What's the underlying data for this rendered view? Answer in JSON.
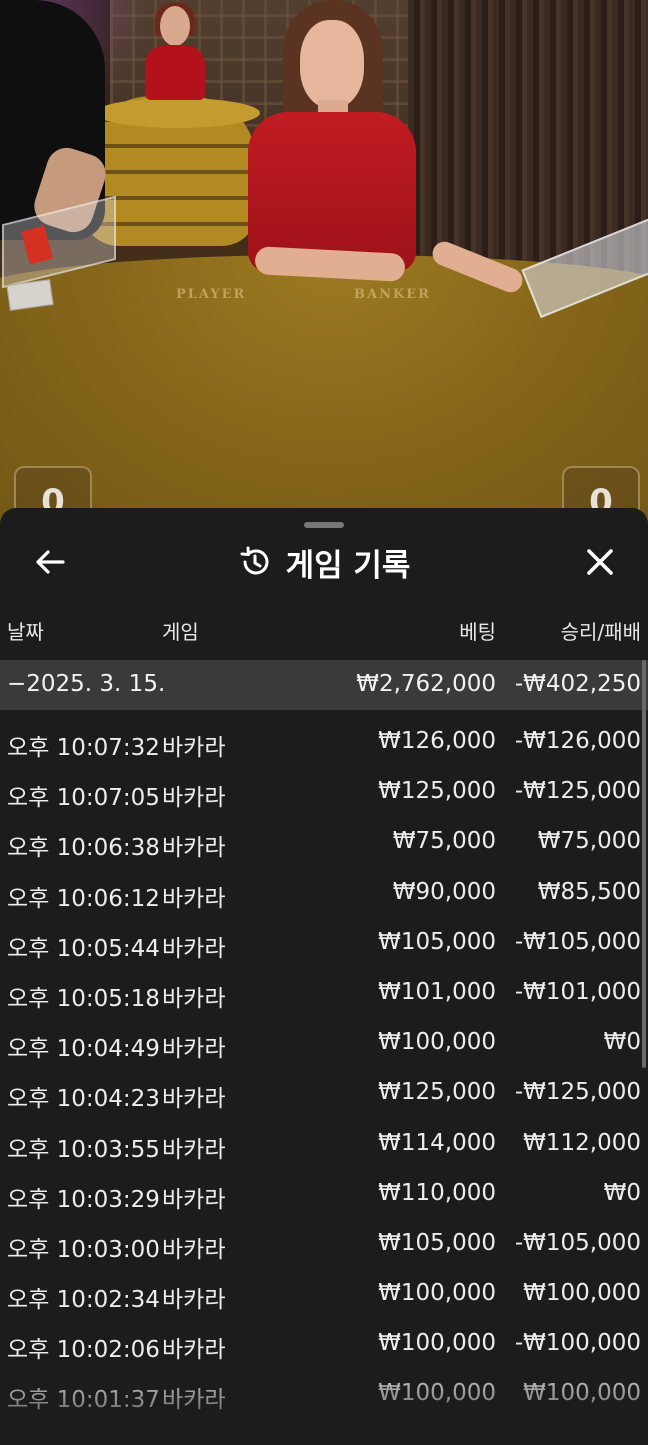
{
  "video": {
    "table_labels": [
      "PLAYER",
      "BANKER"
    ],
    "left_score": "0",
    "right_score": "0"
  },
  "history_sheet": {
    "title": "게임 기록",
    "icons": {
      "back": "arrow-left-icon",
      "history": "history-icon",
      "close": "close-icon"
    },
    "columns": {
      "date": "날짜",
      "game": "게임",
      "bet": "베팅",
      "result": "승리/패배"
    },
    "summary": {
      "date": "−2025. 3. 15.",
      "bet": "₩2,762,000",
      "result": "-₩402,250"
    },
    "rows": [
      {
        "time": "오후 10:07:32",
        "game": "바카라",
        "bet": "₩126,000",
        "result": "-₩126,000"
      },
      {
        "time": "오후 10:07:05",
        "game": "바카라",
        "bet": "₩125,000",
        "result": "-₩125,000"
      },
      {
        "time": "오후 10:06:38",
        "game": "바카라",
        "bet": "₩75,000",
        "result": "₩75,000"
      },
      {
        "time": "오후 10:06:12",
        "game": "바카라",
        "bet": "₩90,000",
        "result": "₩85,500"
      },
      {
        "time": "오후 10:05:44",
        "game": "바카라",
        "bet": "₩105,000",
        "result": "-₩105,000"
      },
      {
        "time": "오후 10:05:18",
        "game": "바카라",
        "bet": "₩101,000",
        "result": "-₩101,000"
      },
      {
        "time": "오후 10:04:49",
        "game": "바카라",
        "bet": "₩100,000",
        "result": "₩0"
      },
      {
        "time": "오후 10:04:23",
        "game": "바카라",
        "bet": "₩125,000",
        "result": "-₩125,000"
      },
      {
        "time": "오후 10:03:55",
        "game": "바카라",
        "bet": "₩114,000",
        "result": "₩112,000"
      },
      {
        "time": "오후 10:03:29",
        "game": "바카라",
        "bet": "₩110,000",
        "result": "₩0"
      },
      {
        "time": "오후 10:03:00",
        "game": "바카라",
        "bet": "₩105,000",
        "result": "-₩105,000"
      },
      {
        "time": "오후 10:02:34",
        "game": "바카라",
        "bet": "₩100,000",
        "result": "₩100,000"
      },
      {
        "time": "오후 10:02:06",
        "game": "바카라",
        "bet": "₩100,000",
        "result": "-₩100,000"
      },
      {
        "time": "오후 10:01:37",
        "game": "바카라",
        "bet": "₩100,000",
        "result": "₩100,000"
      }
    ]
  }
}
